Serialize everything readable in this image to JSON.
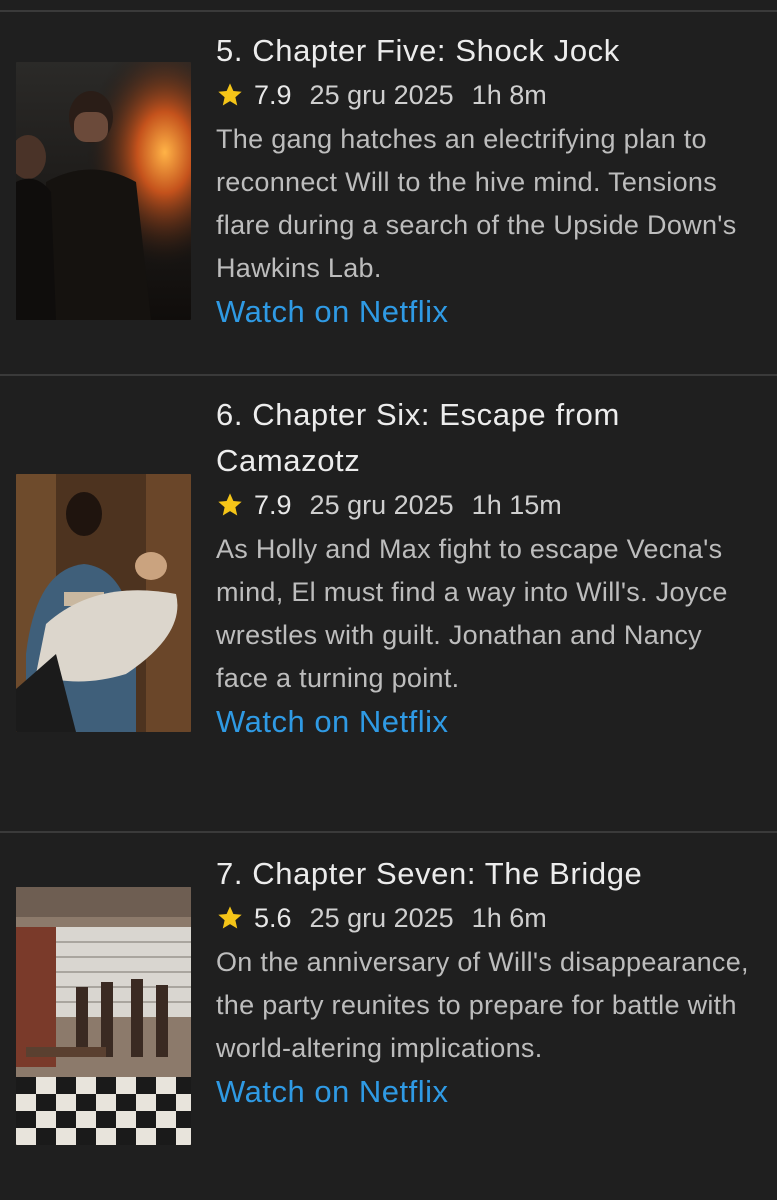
{
  "colors": {
    "background": "#1f1f1f",
    "divider": "#3a3a3a",
    "link": "#2f9ae4",
    "star": "#f5c518"
  },
  "episodes": [
    {
      "title": "5. Chapter Five: Shock Jock",
      "rating": "7.9",
      "date": "25 gru 2025",
      "duration": "1h 8m",
      "description": "The gang hatches an electrifying plan to reconnect Will to the hive mind. Tensions flare during a search of the Upside Down's Hawkins Lab.",
      "link_label": "Watch on Netflix",
      "thumbnail_icon": "episode-5-thumbnail"
    },
    {
      "title": "6. Chapter Six: Escape from Camazotz",
      "rating": "7.9",
      "date": "25 gru 2025",
      "duration": "1h 15m",
      "description": "As Holly and Max fight to escape Vecna's mind, El must find a way into Will's. Joyce wrestles with guilt. Jonathan and Nancy face a turning point.",
      "link_label": "Watch on Netflix",
      "thumbnail_icon": "episode-6-thumbnail"
    },
    {
      "title": "7. Chapter Seven: The Bridge",
      "rating": "5.6",
      "date": "25 gru 2025",
      "duration": "1h 6m",
      "description": "On the anniversary of Will's disappearance, the party reunites to prepare for battle with world-altering implications.",
      "link_label": "Watch on Netflix",
      "thumbnail_icon": "episode-7-thumbnail"
    }
  ]
}
